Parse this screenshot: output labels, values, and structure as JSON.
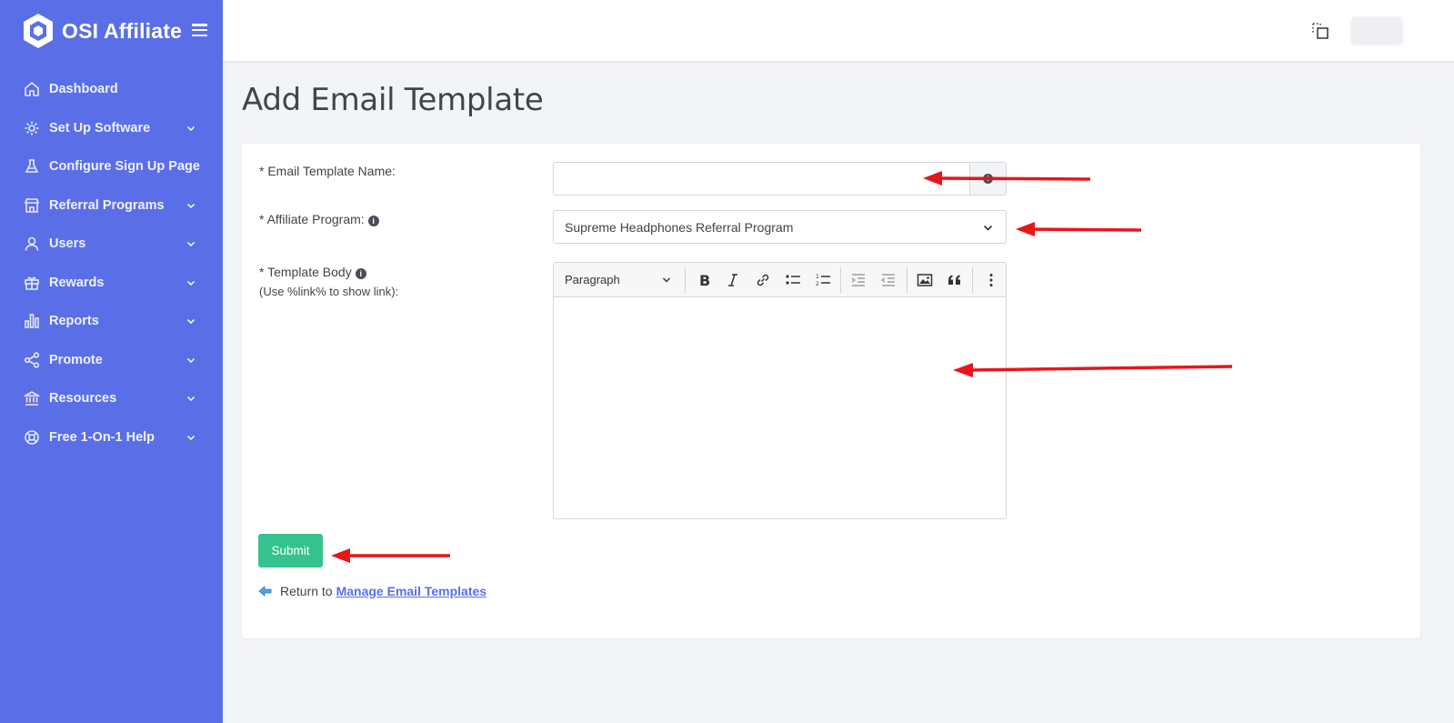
{
  "app": {
    "brand_name": "OSI Affiliate"
  },
  "sidebar": {
    "items": [
      {
        "label": "Dashboard",
        "icon": "home-icon",
        "has_submenu": false
      },
      {
        "label": "Set Up Software",
        "icon": "gear-icon",
        "has_submenu": true
      },
      {
        "label": "Configure Sign Up Page",
        "icon": "flask-icon",
        "has_submenu": false
      },
      {
        "label": "Referral Programs",
        "icon": "store-icon",
        "has_submenu": true
      },
      {
        "label": "Users",
        "icon": "user-icon",
        "has_submenu": true
      },
      {
        "label": "Rewards",
        "icon": "gift-icon",
        "has_submenu": true
      },
      {
        "label": "Reports",
        "icon": "bar-chart-icon",
        "has_submenu": true
      },
      {
        "label": "Promote",
        "icon": "share-icon",
        "has_submenu": true
      },
      {
        "label": "Resources",
        "icon": "bank-icon",
        "has_submenu": true
      },
      {
        "label": "Free 1-On-1 Help",
        "icon": "lifebuoy-icon",
        "has_submenu": true
      }
    ]
  },
  "page": {
    "title": "Add Email Template"
  },
  "form": {
    "name_label": "* Email Template Name:",
    "name_value": "",
    "program_label": "* Affiliate Program:",
    "program_selected": "Supreme Headphones Referral Program",
    "body_label": "* Template Body",
    "body_hint": "(Use %link% to show link):",
    "editor": {
      "block_format": "Paragraph",
      "tools": [
        "bold",
        "italic",
        "link",
        "bulleted-list",
        "numbered-list",
        "indent",
        "outdent",
        "image",
        "blockquote",
        "more"
      ]
    },
    "submit_label": "Submit",
    "return_text": "Return to",
    "return_link": "Manage Email Templates"
  },
  "colors": {
    "sidebar_bg": "#5a6fe7",
    "submit_bg": "#34c38f",
    "link": "#5a6fe7",
    "annotation_arrow": "#e8151b"
  }
}
